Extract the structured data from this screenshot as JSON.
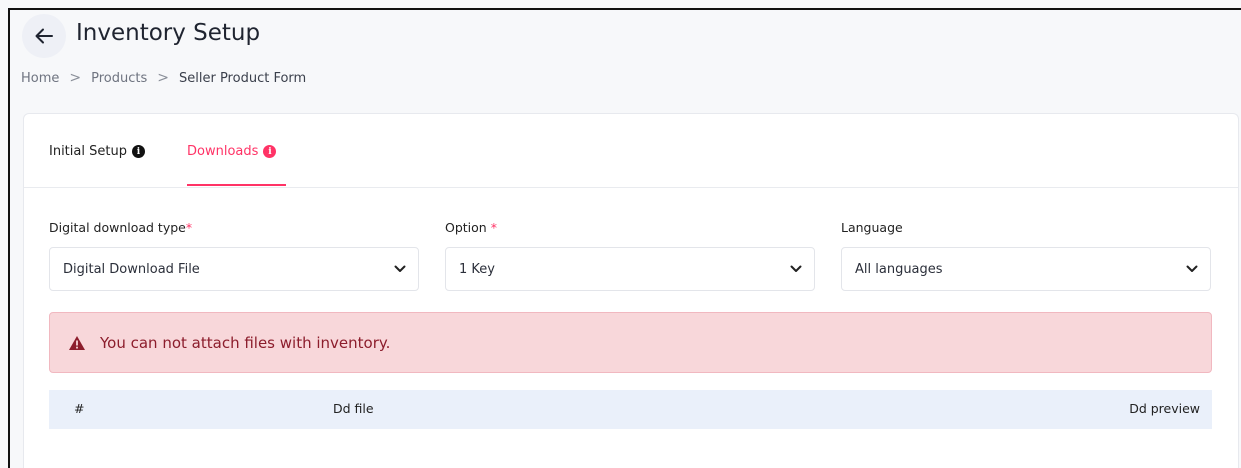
{
  "header": {
    "title": "Inventory Setup",
    "back_icon": "arrow-left-icon"
  },
  "breadcrumb": {
    "items": [
      "Home",
      "Products",
      "Seller Product Form"
    ],
    "separator": ">"
  },
  "tabs": [
    {
      "label": "Initial Setup",
      "active": false
    },
    {
      "label": "Downloads",
      "active": true
    }
  ],
  "colors": {
    "accent": "#ff3366",
    "alert_bg": "#f8d7da",
    "alert_text": "#8c1d2c",
    "table_header_bg": "#eaf0fa"
  },
  "fields": {
    "download_type": {
      "label": "Digital download type",
      "required_mark": "*",
      "value": "Digital Download File"
    },
    "option": {
      "label": "Option ",
      "required_mark": "*",
      "value": "1 Key"
    },
    "language": {
      "label": "Language",
      "value": "All languages"
    }
  },
  "alert": {
    "message": "You can not attach files with inventory.",
    "icon": "warning-triangle-icon"
  },
  "table": {
    "columns": [
      "#",
      "Dd file",
      "Dd preview"
    ]
  }
}
